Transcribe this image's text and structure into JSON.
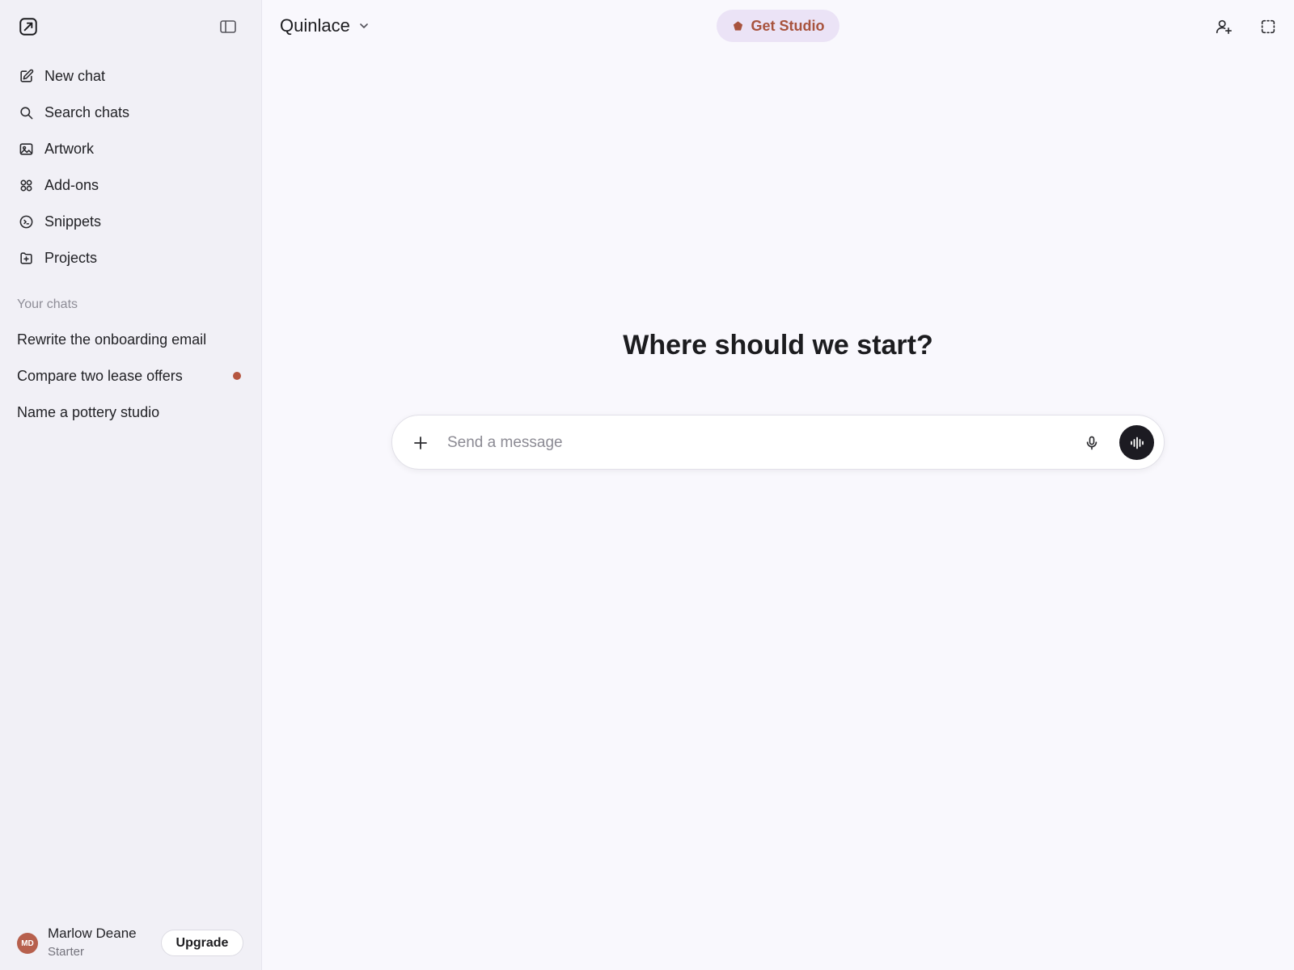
{
  "app": {
    "model_name": "Quinlace",
    "promo_label": "Get Studio"
  },
  "sidebar": {
    "nav": [
      {
        "label": "New chat",
        "icon": "new-chat-icon"
      },
      {
        "label": "Search chats",
        "icon": "search-icon"
      },
      {
        "label": "Artwork",
        "icon": "image-icon"
      },
      {
        "label": "Add-ons",
        "icon": "grid-icon"
      },
      {
        "label": "Snippets",
        "icon": "code-icon"
      },
      {
        "label": "Projects",
        "icon": "folder-plus-icon"
      }
    ],
    "section_title": "Your chats",
    "chats": [
      {
        "label": "Rewrite the onboarding email"
      },
      {
        "label": "Compare two lease offers"
      },
      {
        "label": "Name a pottery studio"
      }
    ]
  },
  "profile": {
    "initials": "MD",
    "name": "Marlow Deane",
    "plan": "Starter",
    "upgrade_label": "Upgrade"
  },
  "main": {
    "headline": "Where should we start?",
    "composer": {
      "placeholder": "Send a message",
      "value": ""
    }
  },
  "colors": {
    "accent": "#a8533d",
    "promo_bg": "#ebe3f6",
    "unread_dot": "#b5553f",
    "voice_button": "#1c1b22"
  }
}
